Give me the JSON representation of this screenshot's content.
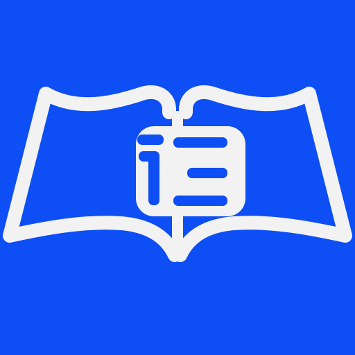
{
  "icon": {
    "name": "open-book-logo-icon",
    "background_color": "#0d4ef5",
    "foreground_color": "#f2f2f2"
  }
}
